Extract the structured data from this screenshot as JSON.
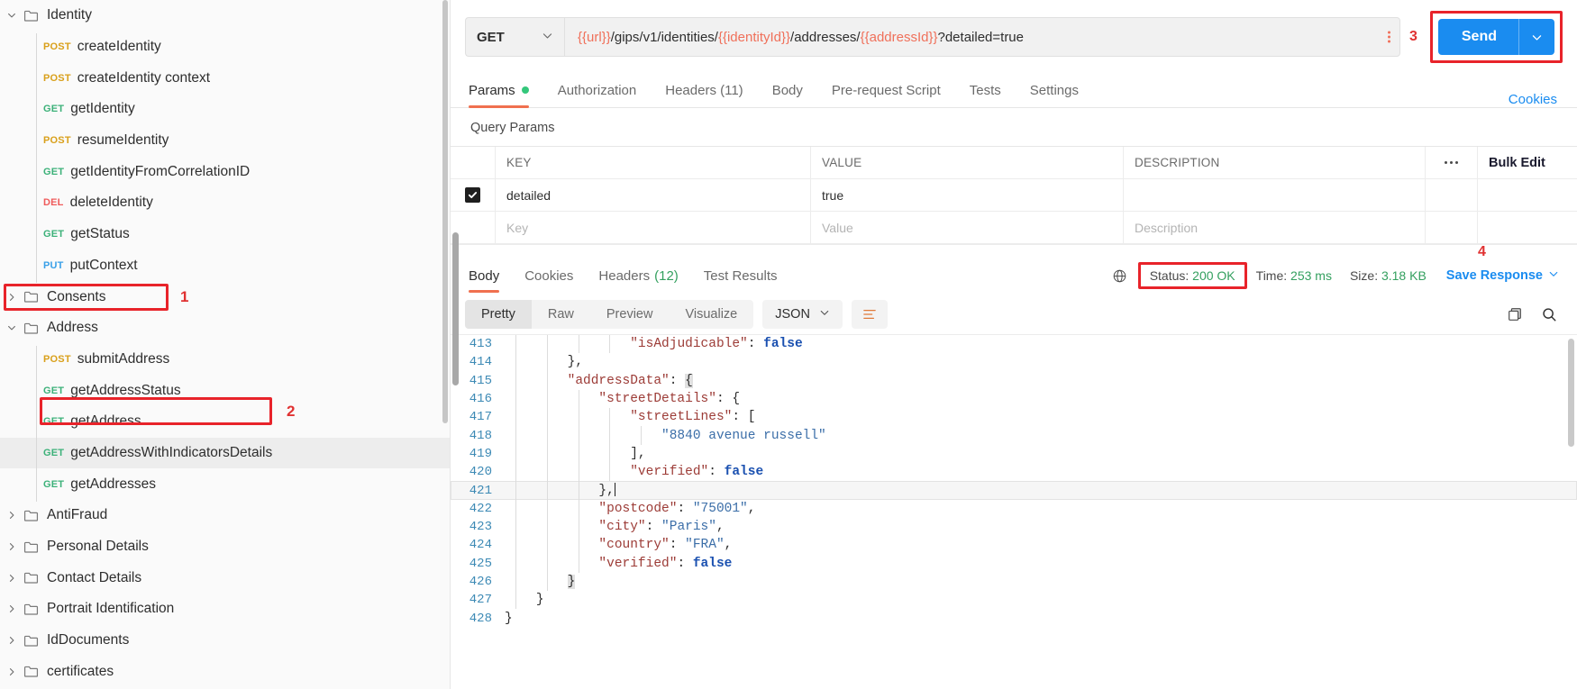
{
  "sidebar": {
    "items": [
      {
        "type": "folder",
        "label": "Identity",
        "expanded": true,
        "indent": 0
      },
      {
        "type": "request",
        "method": "POST",
        "label": "createIdentity",
        "indent": 1
      },
      {
        "type": "request",
        "method": "POST",
        "label": "createIdentity context",
        "indent": 1
      },
      {
        "type": "request",
        "method": "GET",
        "label": "getIdentity",
        "indent": 1
      },
      {
        "type": "request",
        "method": "POST",
        "label": "resumeIdentity",
        "indent": 1
      },
      {
        "type": "request",
        "method": "GET",
        "label": "getIdentityFromCorrelationID",
        "indent": 1
      },
      {
        "type": "request",
        "method": "DEL",
        "label": "deleteIdentity",
        "indent": 1
      },
      {
        "type": "request",
        "method": "GET",
        "label": "getStatus",
        "indent": 1
      },
      {
        "type": "request",
        "method": "PUT",
        "label": "putContext",
        "indent": 1
      },
      {
        "type": "folder",
        "label": "Consents",
        "expanded": false,
        "indent": 0
      },
      {
        "type": "folder",
        "label": "Address",
        "expanded": true,
        "indent": 0,
        "annotation": "1"
      },
      {
        "type": "request",
        "method": "POST",
        "label": "submitAddress",
        "indent": 1
      },
      {
        "type": "request",
        "method": "GET",
        "label": "getAddressStatus",
        "indent": 1
      },
      {
        "type": "request",
        "method": "GET",
        "label": "getAddress",
        "indent": 1
      },
      {
        "type": "request",
        "method": "GET",
        "label": "getAddressWithIndicatorsDetails",
        "indent": 1,
        "selected": true,
        "annotation": "2"
      },
      {
        "type": "request",
        "method": "GET",
        "label": "getAddresses",
        "indent": 1
      },
      {
        "type": "folder",
        "label": "AntiFraud",
        "expanded": false,
        "indent": 0
      },
      {
        "type": "folder",
        "label": "Personal Details",
        "expanded": false,
        "indent": 0
      },
      {
        "type": "folder",
        "label": "Contact Details",
        "expanded": false,
        "indent": 0
      },
      {
        "type": "folder",
        "label": "Portrait Identification",
        "expanded": false,
        "indent": 0
      },
      {
        "type": "folder",
        "label": "IdDocuments",
        "expanded": false,
        "indent": 0
      },
      {
        "type": "folder",
        "label": "certificates",
        "expanded": false,
        "indent": 0
      }
    ]
  },
  "request": {
    "method": "GET",
    "url_parts": [
      {
        "text": "{{url}}",
        "variable": true
      },
      {
        "text": "/gips/v1/identities/",
        "variable": false
      },
      {
        "text": "{{identityId}}",
        "variable": true
      },
      {
        "text": "/addresses/",
        "variable": false
      },
      {
        "text": "{{addressId}}",
        "variable": true
      },
      {
        "text": "?detailed=true",
        "variable": false
      }
    ],
    "url_full": "{{url}}/gips/v1/identities/{{identityId}}/addresses/{{addressId}}?detailed=true",
    "send_label": "Send",
    "send_annotation": "3",
    "tabs": [
      {
        "label": "Params",
        "active": true,
        "dot": true
      },
      {
        "label": "Authorization",
        "active": false
      },
      {
        "label": "Headers (11)",
        "active": false
      },
      {
        "label": "Body",
        "active": false
      },
      {
        "label": "Pre-request Script",
        "active": false
      },
      {
        "label": "Tests",
        "active": false
      },
      {
        "label": "Settings",
        "active": false
      }
    ],
    "cookies_link": "Cookies"
  },
  "query_params": {
    "section_title": "Query Params",
    "columns": [
      "KEY",
      "VALUE",
      "DESCRIPTION"
    ],
    "bulk_edit_label": "Bulk Edit",
    "rows": [
      {
        "checked": true,
        "key": "detailed",
        "value": "true",
        "description": ""
      }
    ],
    "empty_row": {
      "key": "Key",
      "value": "Value",
      "description": "Description"
    }
  },
  "response": {
    "tabs": [
      {
        "label": "Body",
        "active": true
      },
      {
        "label": "Cookies",
        "active": false
      },
      {
        "label": "Headers",
        "count": "(12)",
        "active": false
      },
      {
        "label": "Test Results",
        "active": false
      }
    ],
    "status_label": "Status:",
    "status_value": "200 OK",
    "status_annotation": "4",
    "time_label": "Time:",
    "time_value": "253 ms",
    "size_label": "Size:",
    "size_value": "3.18 KB",
    "save_response": "Save Response",
    "view_modes": [
      {
        "label": "Pretty",
        "active": true
      },
      {
        "label": "Raw",
        "active": false
      },
      {
        "label": "Preview",
        "active": false
      },
      {
        "label": "Visualize",
        "active": false
      }
    ],
    "format": "JSON"
  },
  "code": {
    "lines": [
      {
        "num": "413",
        "indent": 4,
        "tokens": [
          {
            "t": "\"isAdjudicable\"",
            "c": "k"
          },
          {
            "t": ": ",
            "c": "p"
          },
          {
            "t": "false",
            "c": "b"
          }
        ]
      },
      {
        "num": "414",
        "indent": 2,
        "tokens": [
          {
            "t": "},",
            "c": "p"
          }
        ]
      },
      {
        "num": "415",
        "indent": 2,
        "tokens": [
          {
            "t": "\"addressData\"",
            "c": "k"
          },
          {
            "t": ": ",
            "c": "p"
          },
          {
            "t": "{",
            "c": "p",
            "hl": true
          }
        ]
      },
      {
        "num": "416",
        "indent": 3,
        "tokens": [
          {
            "t": "\"streetDetails\"",
            "c": "k"
          },
          {
            "t": ": {",
            "c": "p"
          }
        ]
      },
      {
        "num": "417",
        "indent": 4,
        "tokens": [
          {
            "t": "\"streetLines\"",
            "c": "k"
          },
          {
            "t": ": [",
            "c": "p"
          }
        ]
      },
      {
        "num": "418",
        "indent": 5,
        "tokens": [
          {
            "t": "\"8840 avenue russell\"",
            "c": "s"
          }
        ]
      },
      {
        "num": "419",
        "indent": 4,
        "tokens": [
          {
            "t": "],",
            "c": "p"
          }
        ]
      },
      {
        "num": "420",
        "indent": 4,
        "tokens": [
          {
            "t": "\"verified\"",
            "c": "k"
          },
          {
            "t": ": ",
            "c": "p"
          },
          {
            "t": "false",
            "c": "b"
          }
        ]
      },
      {
        "num": "421",
        "indent": 3,
        "tokens": [
          {
            "t": "},",
            "c": "p"
          }
        ],
        "cursor": true,
        "highlight": true
      },
      {
        "num": "422",
        "indent": 3,
        "tokens": [
          {
            "t": "\"postcode\"",
            "c": "k"
          },
          {
            "t": ": ",
            "c": "p"
          },
          {
            "t": "\"75001\"",
            "c": "s"
          },
          {
            "t": ",",
            "c": "p"
          }
        ]
      },
      {
        "num": "423",
        "indent": 3,
        "tokens": [
          {
            "t": "\"city\"",
            "c": "k"
          },
          {
            "t": ": ",
            "c": "p"
          },
          {
            "t": "\"Paris\"",
            "c": "s"
          },
          {
            "t": ",",
            "c": "p"
          }
        ]
      },
      {
        "num": "424",
        "indent": 3,
        "tokens": [
          {
            "t": "\"country\"",
            "c": "k"
          },
          {
            "t": ": ",
            "c": "p"
          },
          {
            "t": "\"FRA\"",
            "c": "s"
          },
          {
            "t": ",",
            "c": "p"
          }
        ]
      },
      {
        "num": "425",
        "indent": 3,
        "tokens": [
          {
            "t": "\"verified\"",
            "c": "k"
          },
          {
            "t": ": ",
            "c": "p"
          },
          {
            "t": "false",
            "c": "b"
          }
        ]
      },
      {
        "num": "426",
        "indent": 2,
        "tokens": [
          {
            "t": "}",
            "c": "p",
            "hl": true
          }
        ]
      },
      {
        "num": "427",
        "indent": 1,
        "tokens": [
          {
            "t": "}",
            "c": "p"
          }
        ]
      },
      {
        "num": "428",
        "indent": 0,
        "tokens": [
          {
            "t": "}",
            "c": "p"
          }
        ]
      }
    ]
  },
  "colors": {
    "accent_blue": "#1a8cf0",
    "tab_underline": "#f0704f",
    "annotation_red": "#e8232a",
    "method_get": "#3cb179",
    "method_post": "#d9a01b",
    "method_del": "#ef5b5b",
    "method_put": "#3aa0e8",
    "status_ok": "#34a05f",
    "variable": "#f0705a"
  }
}
